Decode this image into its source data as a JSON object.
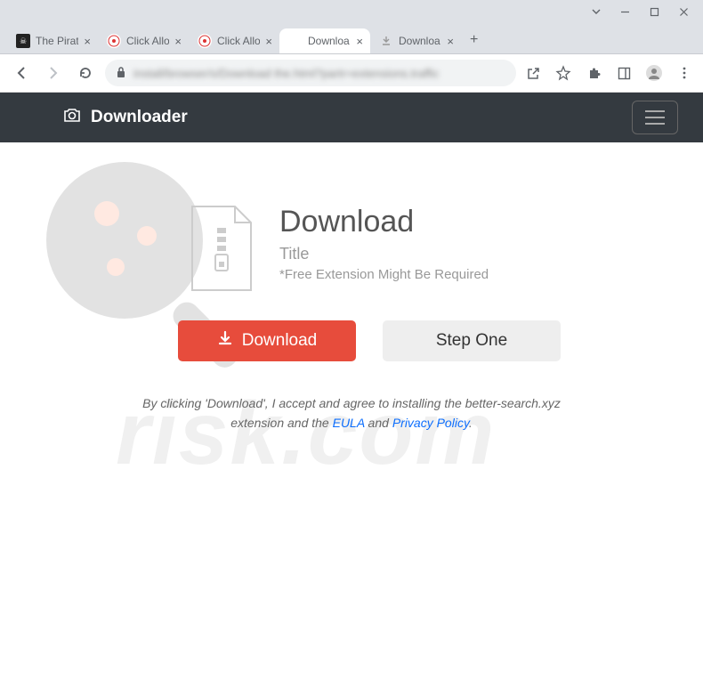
{
  "window": {
    "tabs": [
      {
        "title": "The Pirat",
        "favicon": "pirate"
      },
      {
        "title": "Click Allo",
        "favicon": "click"
      },
      {
        "title": "Click Allo",
        "favicon": "click"
      },
      {
        "title": "Downloa",
        "favicon": "none",
        "active": true
      },
      {
        "title": "Downloa",
        "favicon": "download"
      }
    ],
    "url_blurred": "install/browser/s/Download the.html?partr=extensions.traffic"
  },
  "header": {
    "brand": "Downloader"
  },
  "hero": {
    "heading": "Download",
    "subtitle": "Title",
    "note": "*Free Extension Might Be Required"
  },
  "buttons": {
    "download": "Download",
    "step": "Step One"
  },
  "disclaimer": {
    "text_before": "By clicking 'Download', I accept and agree to installing the better-search.xyz extension and the ",
    "eula": "EULA",
    "and": " and ",
    "privacy": "Privacy Policy",
    "period": "."
  },
  "watermark": {
    "text": "risk.com"
  }
}
